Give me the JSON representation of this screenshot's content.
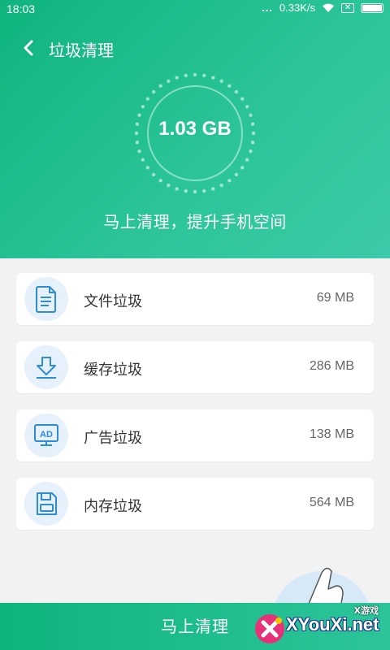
{
  "status_bar": {
    "time": "18:03",
    "dots": "...",
    "network_speed": "0.33K/s",
    "x_badge": "✕"
  },
  "topbar": {
    "title": "垃圾清理"
  },
  "summary": {
    "total_size": "1.03 GB",
    "tagline": "马上清理，提升手机空间"
  },
  "items": [
    {
      "label": "文件垃圾",
      "size": "69 MB",
      "icon": "document-icon"
    },
    {
      "label": "缓存垃圾",
      "size": "286 MB",
      "icon": "download-icon"
    },
    {
      "label": "广告垃圾",
      "size": "138 MB",
      "icon": "ad-monitor-icon"
    },
    {
      "label": "内存垃圾",
      "size": "564 MB",
      "icon": "memory-card-icon"
    }
  ],
  "action": {
    "clean_label": "马上清理"
  },
  "watermark": {
    "top_text": "X游戏",
    "site_text": "XYouXi.net"
  },
  "colors": {
    "primary_green": "#0fb47e",
    "accent_teal": "#3ccaa8",
    "icon_blue": "#2e8bd4",
    "icon_bg": "#e6f1fb"
  }
}
